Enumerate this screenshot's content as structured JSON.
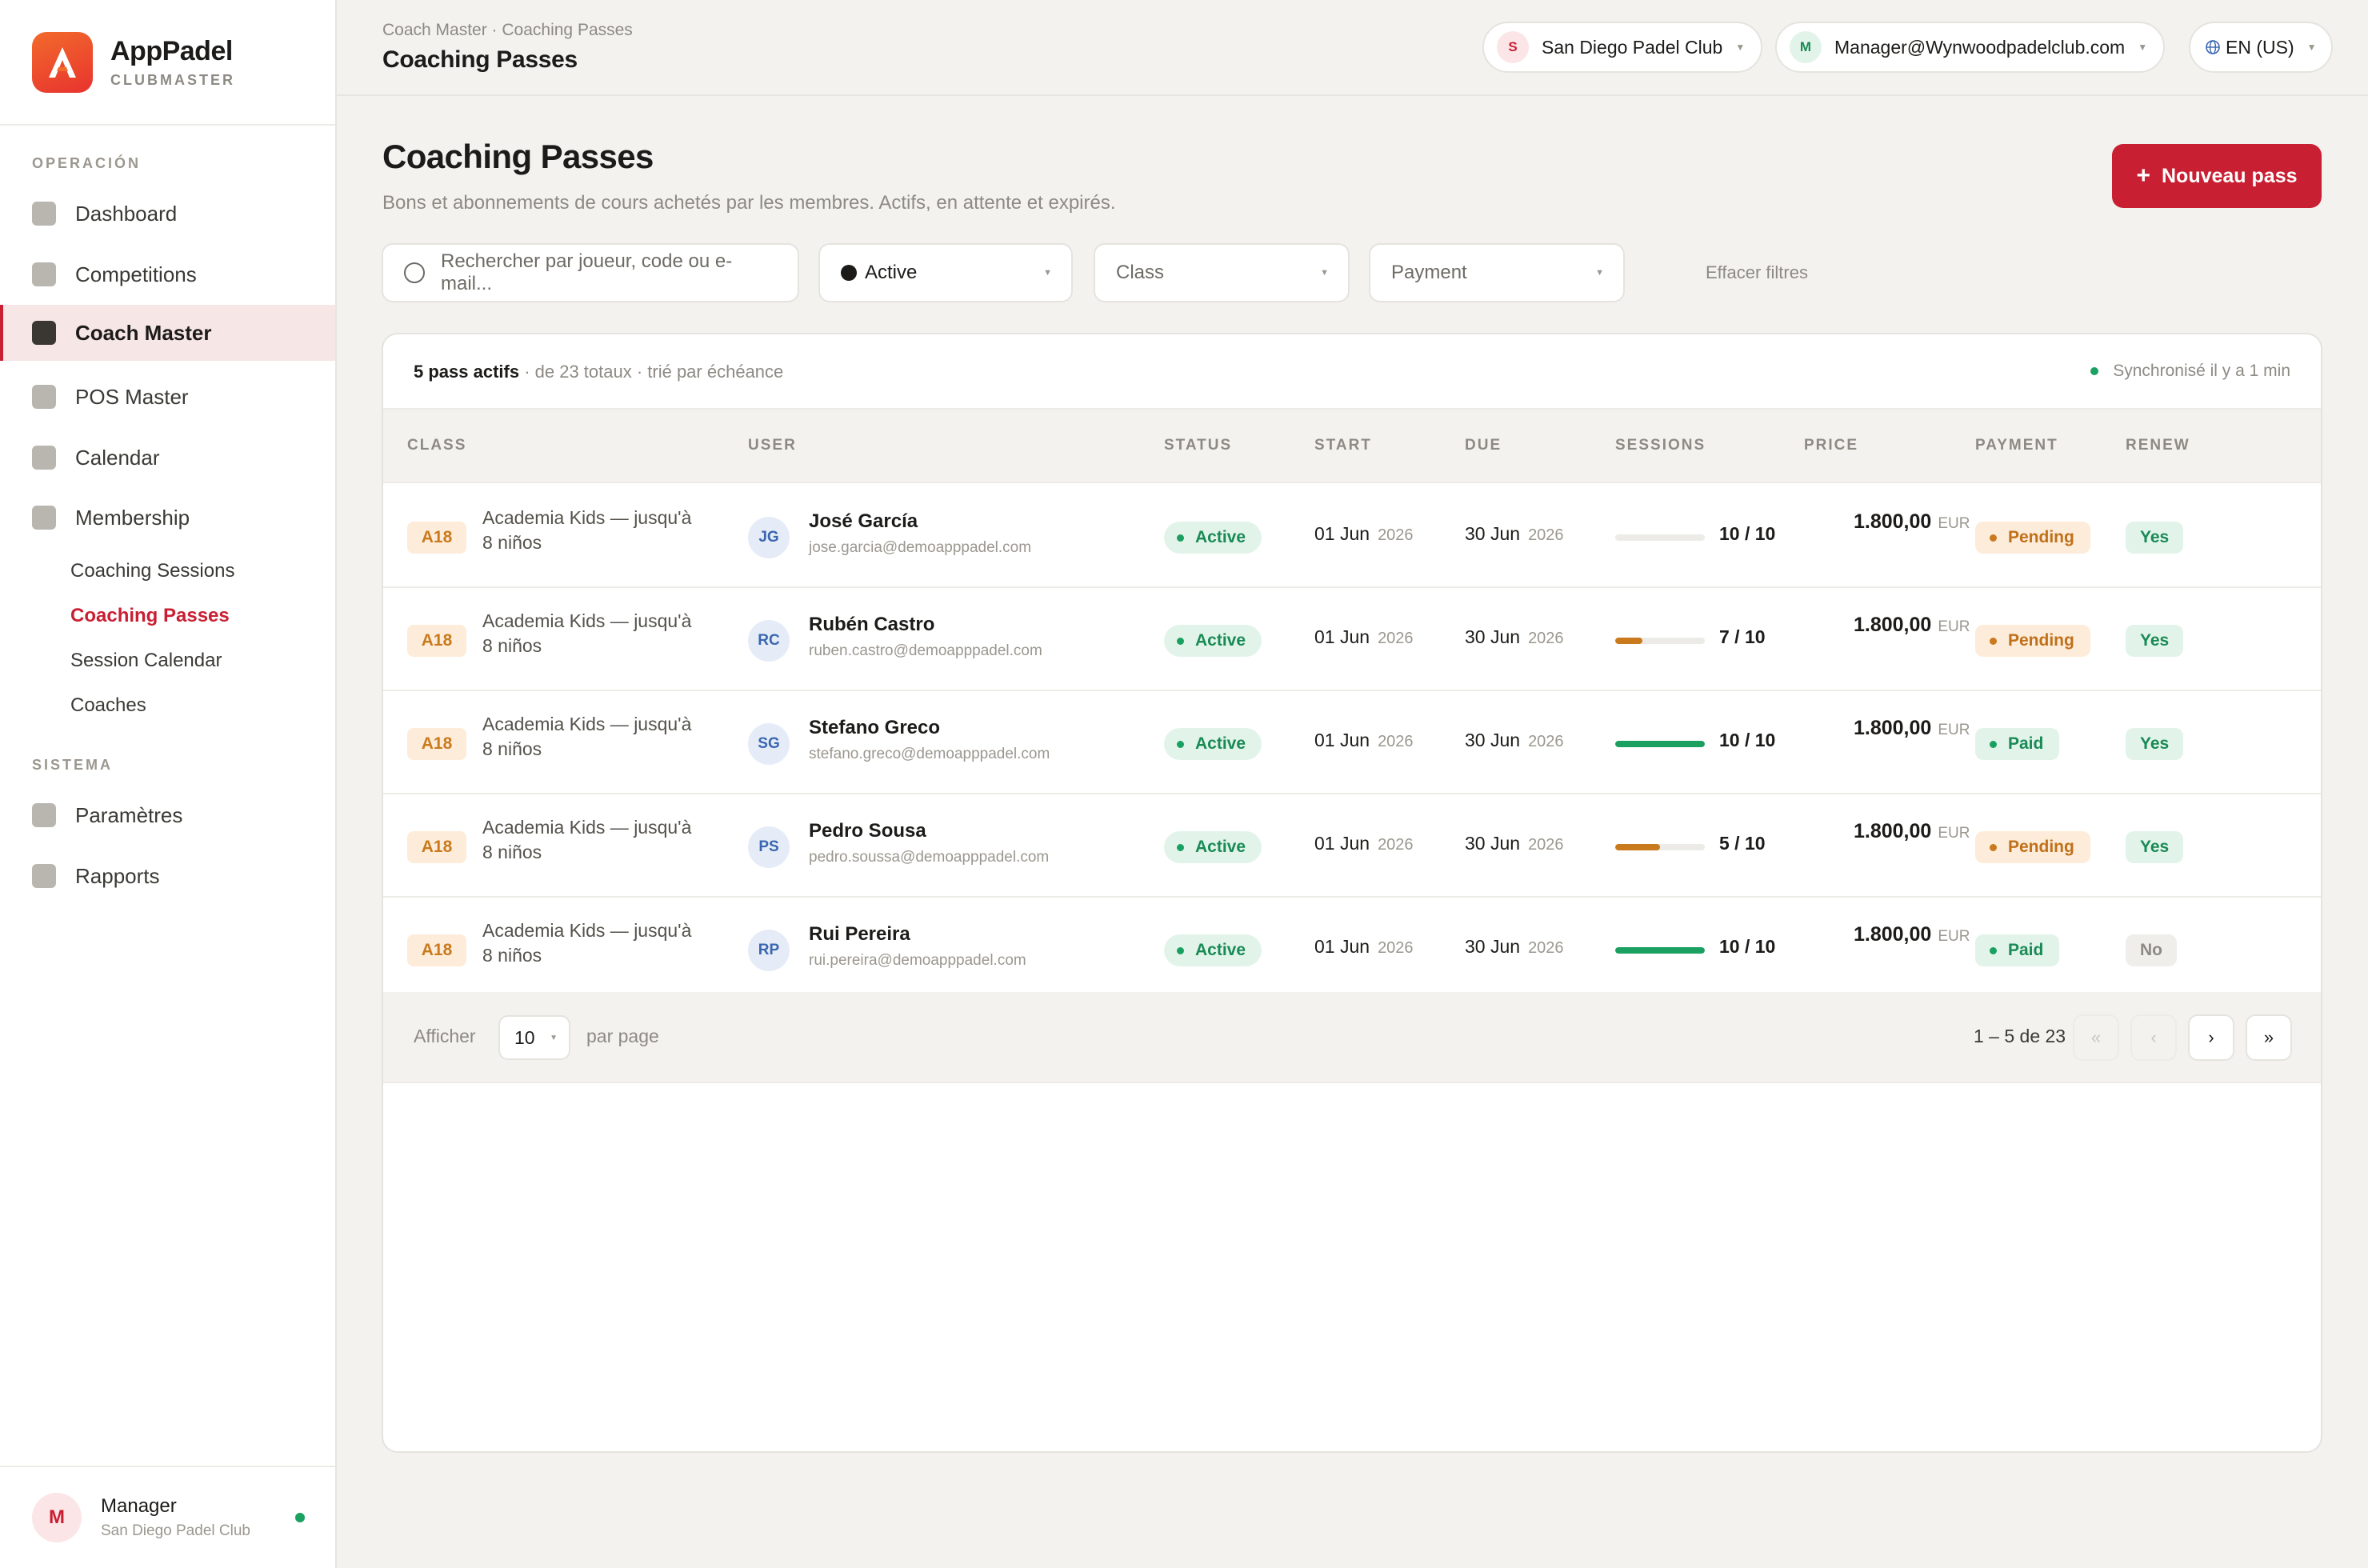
{
  "brand": {
    "name": "AppPadel",
    "sub": "CLUBMASTER"
  },
  "nav": {
    "section_operation": "OPERACIÓN",
    "section_system": "SISTEMA",
    "items": [
      {
        "label": "Dashboard"
      },
      {
        "label": "Competitions"
      },
      {
        "label": "Coach Master"
      },
      {
        "label": "POS Master"
      },
      {
        "label": "Calendar"
      },
      {
        "label": "Membership"
      }
    ],
    "subitems": [
      {
        "label": "Coaching Sessions"
      },
      {
        "label": "Coaching Passes"
      },
      {
        "label": "Session Calendar"
      },
      {
        "label": "Coaches"
      }
    ],
    "system_items": [
      {
        "label": "Paramètres"
      },
      {
        "label": "Rapports"
      }
    ]
  },
  "footer_user": {
    "initial": "M",
    "name": "Manager",
    "club": "San Diego Padel Club"
  },
  "topbar": {
    "breadcrumb": "Coach Master · Coaching Passes",
    "title": "Coaching Passes",
    "club": {
      "initial": "S",
      "label": "San Diego Padel Club"
    },
    "account": {
      "initial": "M",
      "label": "Manager@Wynwoodpadelclub.com"
    },
    "lang": "EN (US)"
  },
  "page": {
    "title": "Coaching Passes",
    "subtitle": "Bons et abonnements de cours achetés par les membres. Actifs, en attente et expirés.",
    "new_button": "Nouveau pass"
  },
  "filters": {
    "search_placeholder": "Rechercher par joueur, code ou e-mail...",
    "status": "Active",
    "class": "Class",
    "payment": "Payment",
    "clear": "Effacer filtres"
  },
  "card": {
    "count_bold": "5 pass actifs",
    "count_rest": " · de 23 totaux · trié par échéance",
    "sync": "Synchronisé il y a 1 min"
  },
  "columns": [
    "CLASS",
    "USER",
    "STATUS",
    "START",
    "DUE",
    "SESSIONS",
    "PRICE",
    "PAYMENT",
    "RENEW"
  ],
  "rows": [
    {
      "code": "A18",
      "class_line1": "Academia Kids — jusqu'à",
      "class_line2": "8 niños",
      "initials": "JG",
      "name": "José García",
      "email": "jose.garcia@demoapppadel.com",
      "status": "Active",
      "start": "01 Jun",
      "start_year": "2026",
      "due": "30 Jun",
      "due_year": "2026",
      "sessions": "10 / 10",
      "progress": 0.0,
      "progress_color": "#e3e1dc",
      "price": "1.800,00",
      "currency": "EUR",
      "payment": "Pending",
      "renew": "Yes"
    },
    {
      "code": "A18",
      "class_line1": "Academia Kids — jusqu'à",
      "class_line2": "8 niños",
      "initials": "RC",
      "name": "Rubén Castro",
      "email": "ruben.castro@demoapppadel.com",
      "status": "Active",
      "start": "01 Jun",
      "start_year": "2026",
      "due": "30 Jun",
      "due_year": "2026",
      "sessions": "7 / 10",
      "progress": 0.3,
      "progress_color": "#c97a1d",
      "price": "1.800,00",
      "currency": "EUR",
      "payment": "Pending",
      "renew": "Yes"
    },
    {
      "code": "A18",
      "class_line1": "Academia Kids — jusqu'à",
      "class_line2": "8 niños",
      "initials": "SG",
      "name": "Stefano Greco",
      "email": "stefano.greco@demoapppadel.com",
      "status": "Active",
      "start": "01 Jun",
      "start_year": "2026",
      "due": "30 Jun",
      "due_year": "2026",
      "sessions": "10 / 10",
      "progress": 1.0,
      "progress_color": "#1aa061",
      "price": "1.800,00",
      "currency": "EUR",
      "payment": "Paid",
      "renew": "Yes"
    },
    {
      "code": "A18",
      "class_line1": "Academia Kids — jusqu'à",
      "class_line2": "8 niños",
      "initials": "PS",
      "name": "Pedro Sousa",
      "email": "pedro.soussa@demoapppadel.com",
      "status": "Active",
      "start": "01 Jun",
      "start_year": "2026",
      "due": "30 Jun",
      "due_year": "2026",
      "sessions": "5 / 10",
      "progress": 0.5,
      "progress_color": "#c97a1d",
      "price": "1.800,00",
      "currency": "EUR",
      "payment": "Pending",
      "renew": "Yes"
    },
    {
      "code": "A18",
      "class_line1": "Academia Kids — jusqu'à",
      "class_line2": "8 niños",
      "initials": "RP",
      "name": "Rui Pereira",
      "email": "rui.pereira@demoapppadel.com",
      "status": "Active",
      "start": "01 Jun",
      "start_year": "2026",
      "due": "30 Jun",
      "due_year": "2026",
      "sessions": "10 / 10",
      "progress": 1.0,
      "progress_color": "#1aa061",
      "price": "1.800,00",
      "currency": "EUR",
      "payment": "Paid",
      "renew": "No"
    }
  ],
  "pagination": {
    "show": "Afficher",
    "per_page_value": "10",
    "per_page": "par page",
    "range": "1 – 5 de 23",
    "first": "«",
    "prev": "‹",
    "next": "›",
    "last": "»"
  }
}
